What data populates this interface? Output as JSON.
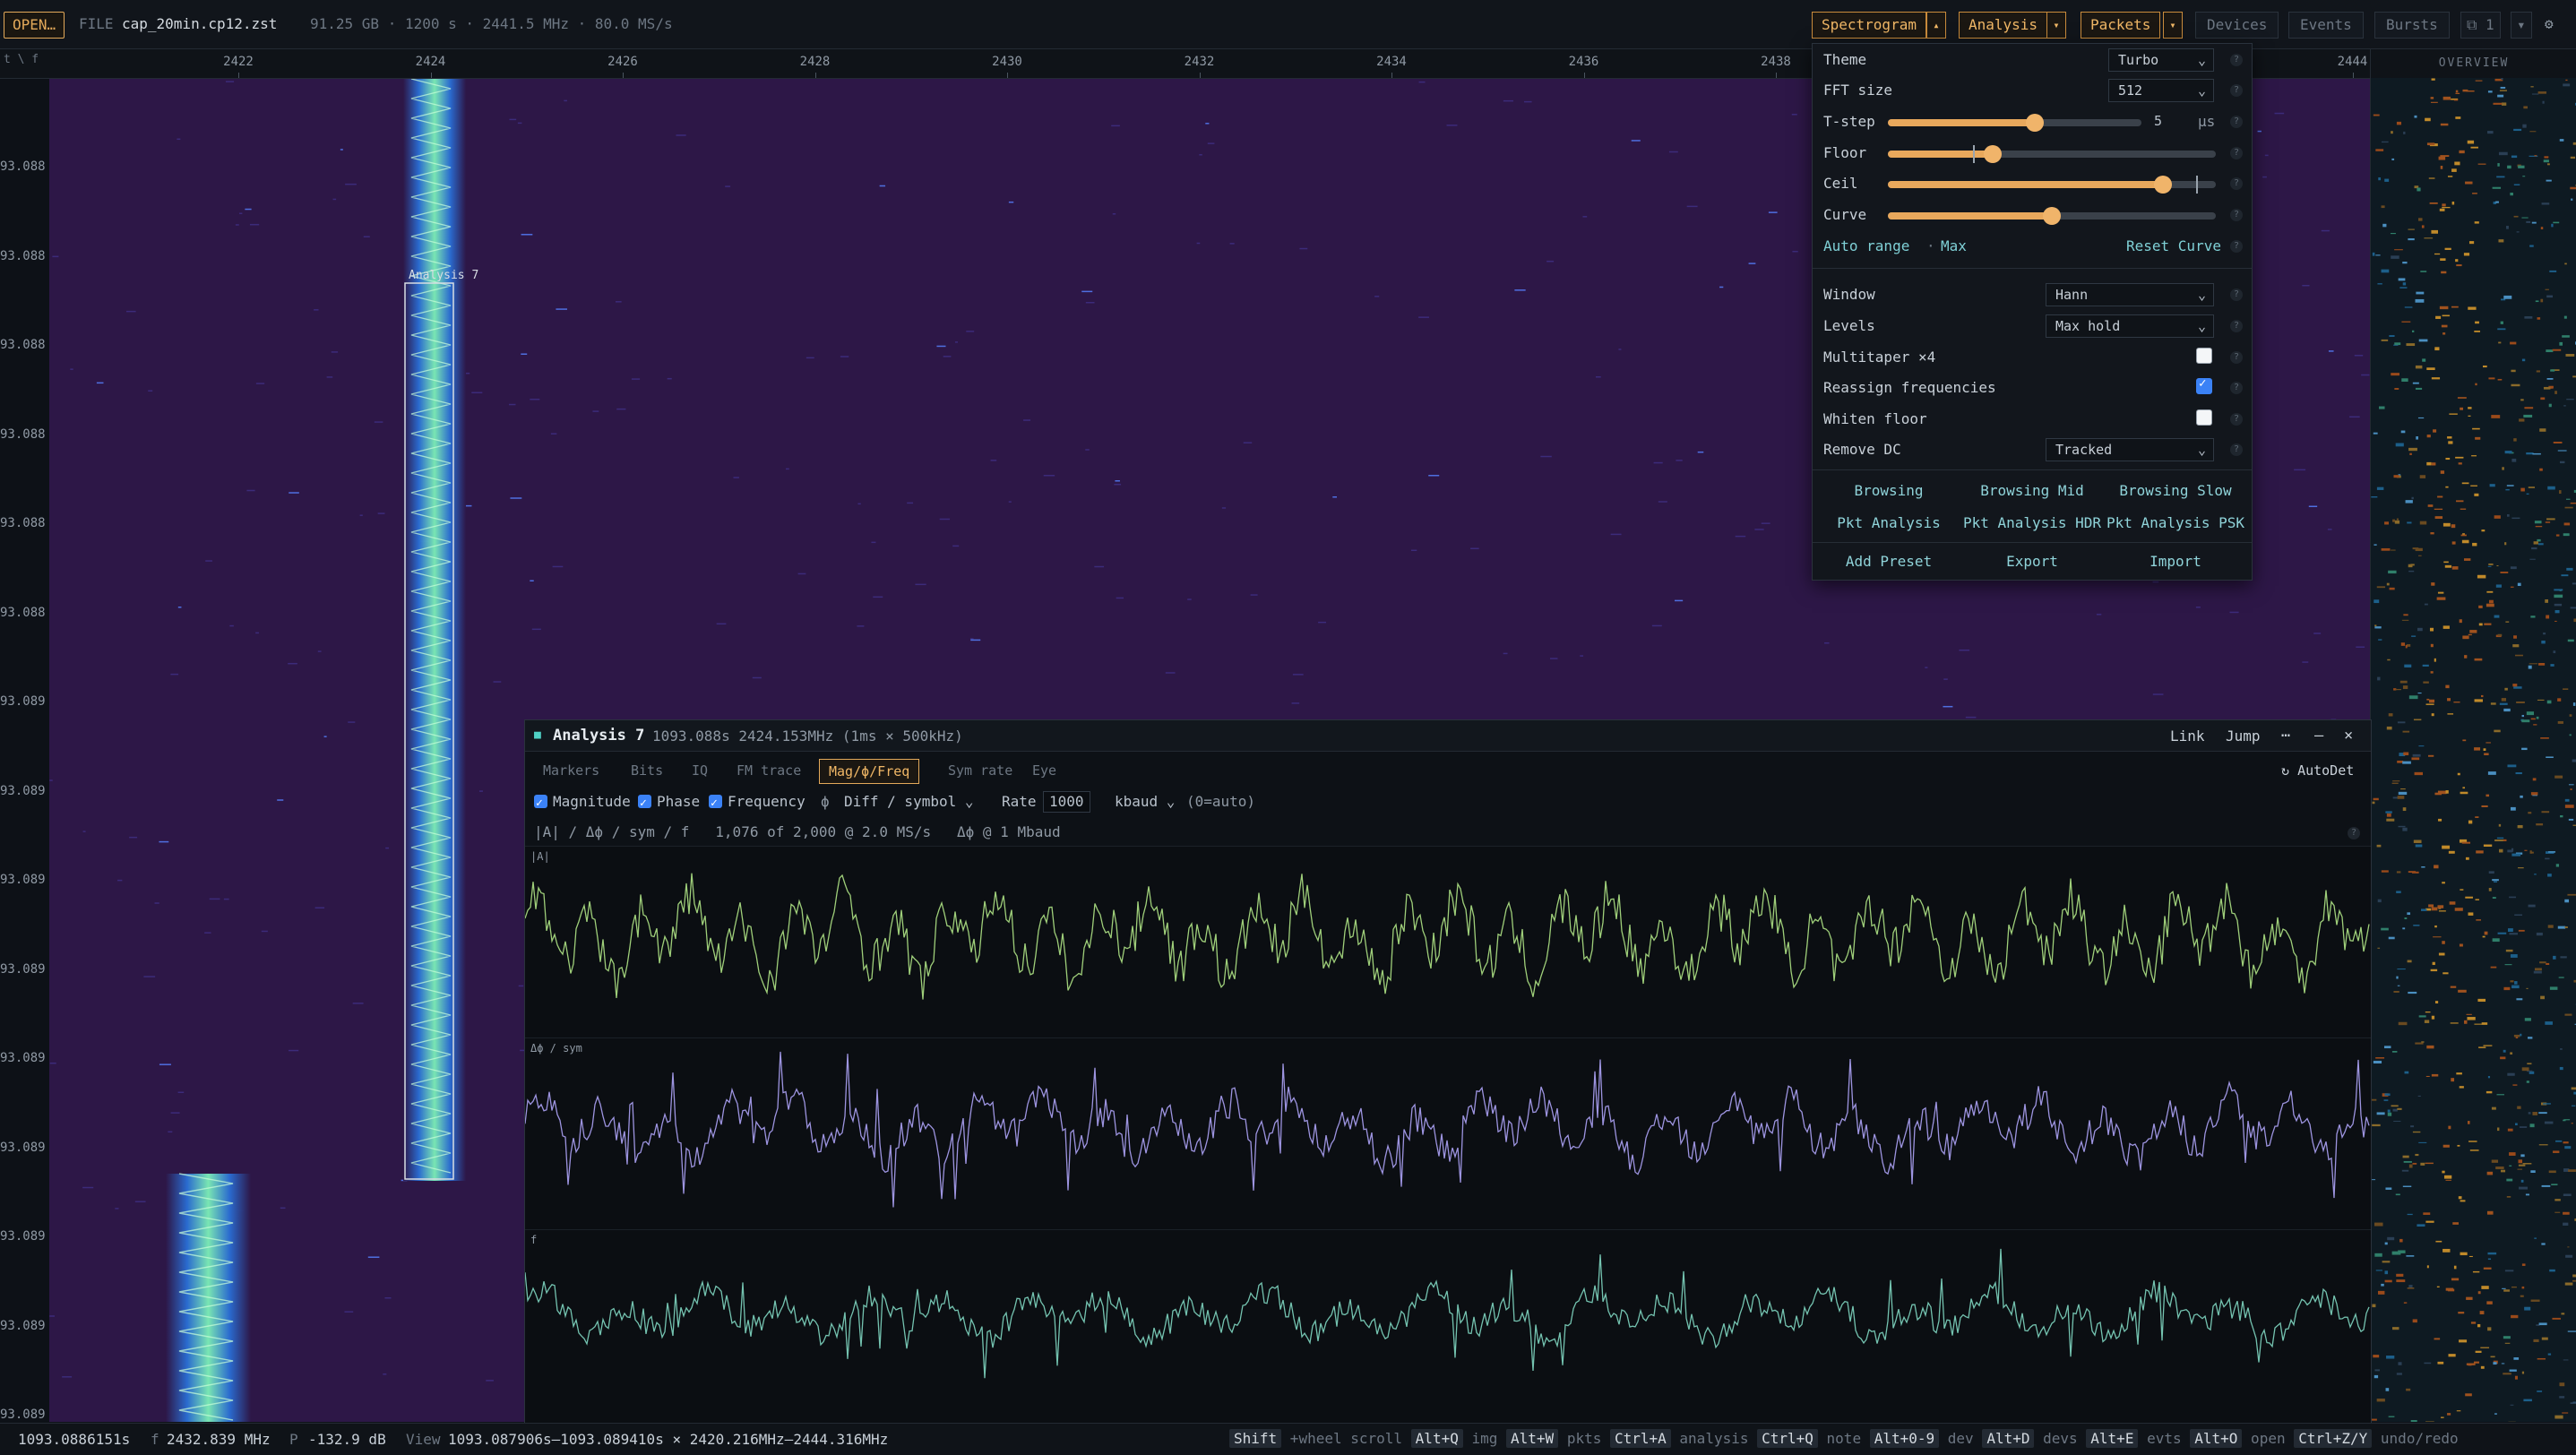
{
  "topbar": {
    "open_label": "OPEN…",
    "file_prefix": "FILE",
    "file_name": "cap_20min.cp12.zst",
    "file_info": "91.25 GB · 1200 s · 2441.5 MHz · 80.0 MS/s",
    "spectrogram_label": "Spectrogram",
    "analysis_label": "Analysis",
    "packets_label": "Packets",
    "devices_label": "Devices",
    "events_label": "Events",
    "bursts_label": "Bursts",
    "window_count": "⧉ 1"
  },
  "ruler": {
    "corner": "t \\ f",
    "ticks": [
      "2422",
      "2424",
      "2426",
      "2428",
      "2430",
      "2432",
      "2434",
      "2436",
      "2438",
      "2440",
      "2442",
      "2444"
    ]
  },
  "time_axis": {
    "labels": [
      "93.088",
      "93.088",
      "93.088",
      "93.088",
      "93.088",
      "93.088",
      "93.089",
      "93.089",
      "93.089",
      "93.089",
      "93.089",
      "93.089",
      "93.089",
      "93.089",
      "93.089"
    ]
  },
  "spectrogram": {
    "packet_label": "Analysis 7",
    "colormap": "#2d1747"
  },
  "overview": {
    "title": "OVERVIEW"
  },
  "settings": {
    "theme_label": "Theme",
    "theme_value": "Turbo",
    "fft_label": "FFT size",
    "fft_value": "512",
    "tstep_label": "T-step",
    "tstep_value": "5",
    "tstep_unit": "µs",
    "floor_label": "Floor",
    "ceil_label": "Ceil",
    "curve_label": "Curve",
    "tstep_pos": 0.58,
    "floor_pos": 0.32,
    "ceil_pos": 0.84,
    "curve_pos": 0.5,
    "auto_range": "Auto range",
    "max": "Max",
    "reset_curve": "Reset Curve",
    "window_label": "Window",
    "window_value": "Hann",
    "levels_label": "Levels",
    "levels_value": "Max hold",
    "multitaper_label": "Multitaper ×4",
    "multitaper_on": false,
    "reassign_label": "Reassign frequencies",
    "reassign_on": true,
    "whiten_label": "Whiten floor",
    "whiten_on": false,
    "removedc_label": "Remove DC",
    "removedc_value": "Tracked",
    "presets": [
      "Browsing",
      "Browsing Mid",
      "Browsing Slow",
      "Pkt Analysis",
      "Pkt Analysis HDR",
      "Pkt Analysis PSK"
    ],
    "add_preset": "Add Preset",
    "export": "Export",
    "import": "Import"
  },
  "analysis": {
    "title": "Analysis 7",
    "subtitle": "1093.088s 2424.153MHz (1ms × 500kHz)",
    "link": "Link",
    "jump": "Jump",
    "more": "⋯",
    "minimize": "–",
    "close": "×",
    "tabs": [
      "Markers",
      "Bits",
      "IQ",
      "FM trace",
      "Mag/ϕ/Freq",
      "Sym rate",
      "Eye"
    ],
    "active_tab": "Mag/ϕ/Freq",
    "autodet": "AutoDet",
    "magnitude": "Magnitude",
    "phase": "Phase",
    "frequency": "Frequency",
    "phi": "ϕ",
    "phase_mode": "Diff / symbol",
    "rate_label": "Rate",
    "rate_value": "1000",
    "rate_unit": "kbaud",
    "rate_hint": "(0=auto)",
    "summary": "|A| / Δϕ / sym / f   1,076 of 2,000 @ 2.0 MS/s   Δϕ @ 1 Mbaud",
    "plot_mag": "|A|",
    "plot_phase": "Δϕ / sym",
    "plot_freq": "f",
    "colors": {
      "mag": "#9fcf7a",
      "phase": "#9d94e0",
      "freq": "#74c3b0"
    }
  },
  "status": {
    "time": "1093.0886151s",
    "freq_label": "f",
    "freq": "2432.839 MHz",
    "power_label": "P",
    "power": "-132.9 dB",
    "view_label": "View",
    "view": "1093.087906s–1093.089410s × 2420.216MHz–2444.316MHz",
    "hints": [
      {
        "k": "Shift",
        "t": "+wheel scroll"
      },
      {
        "k": "Alt+Q",
        "t": "img"
      },
      {
        "k": "Alt+W",
        "t": "pkts"
      },
      {
        "k": "Ctrl+A",
        "t": "analysis"
      },
      {
        "k": "Ctrl+Q",
        "t": "note"
      },
      {
        "k": "Alt+0-9",
        "t": "dev"
      },
      {
        "k": "Alt+D",
        "t": "devs"
      },
      {
        "k": "Alt+E",
        "t": "evts"
      },
      {
        "k": "Alt+O",
        "t": "open"
      },
      {
        "k": "Ctrl+Z/Y",
        "t": "undo/redo"
      }
    ]
  }
}
